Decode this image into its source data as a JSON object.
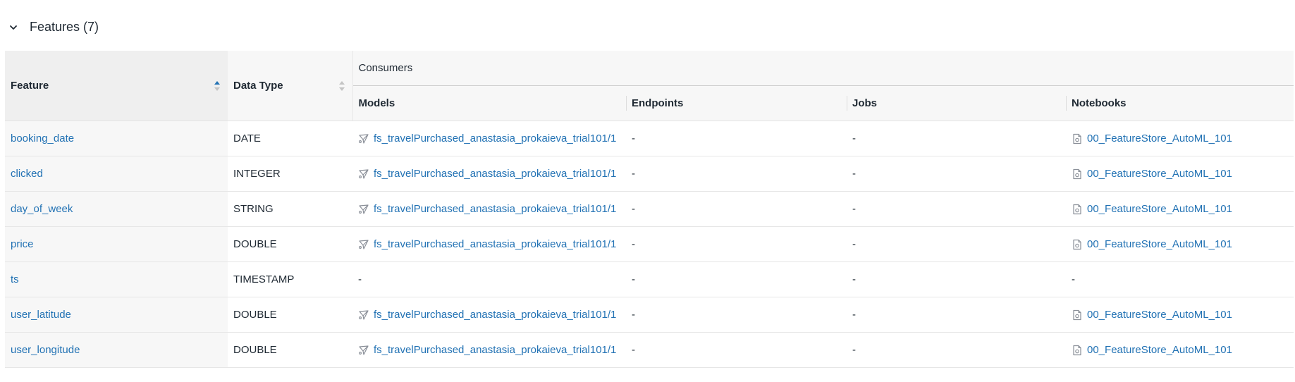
{
  "section": {
    "title": "Features (7)"
  },
  "columns": {
    "feature": "Feature",
    "data_type": "Data Type",
    "consumers": "Consumers",
    "models": "Models",
    "endpoints": "Endpoints",
    "jobs": "Jobs",
    "notebooks": "Notebooks"
  },
  "rows": [
    {
      "feature": "booking_date",
      "data_type": "DATE",
      "model": "fs_travelPurchased_anastasia_prokaieva_trial101/1",
      "endpoint": "-",
      "job": "-",
      "notebook": "00_FeatureStore_AutoML_101"
    },
    {
      "feature": "clicked",
      "data_type": "INTEGER",
      "model": "fs_travelPurchased_anastasia_prokaieva_trial101/1",
      "endpoint": "-",
      "job": "-",
      "notebook": "00_FeatureStore_AutoML_101"
    },
    {
      "feature": "day_of_week",
      "data_type": "STRING",
      "model": "fs_travelPurchased_anastasia_prokaieva_trial101/1",
      "endpoint": "-",
      "job": "-",
      "notebook": "00_FeatureStore_AutoML_101"
    },
    {
      "feature": "price",
      "data_type": "DOUBLE",
      "model": "fs_travelPurchased_anastasia_prokaieva_trial101/1",
      "endpoint": "-",
      "job": "-",
      "notebook": "00_FeatureStore_AutoML_101"
    },
    {
      "feature": "ts",
      "data_type": "TIMESTAMP",
      "model": "-",
      "endpoint": "-",
      "job": "-",
      "notebook": "-"
    },
    {
      "feature": "user_latitude",
      "data_type": "DOUBLE",
      "model": "fs_travelPurchased_anastasia_prokaieva_trial101/1",
      "endpoint": "-",
      "job": "-",
      "notebook": "00_FeatureStore_AutoML_101"
    },
    {
      "feature": "user_longitude",
      "data_type": "DOUBLE",
      "model": "fs_travelPurchased_anastasia_prokaieva_trial101/1",
      "endpoint": "-",
      "job": "-",
      "notebook": "00_FeatureStore_AutoML_101"
    }
  ],
  "icons": {
    "collapse": "chevron-down-icon",
    "model": "model-icon",
    "notebook": "notebook-icon",
    "sort": "sort-icon"
  },
  "colors": {
    "link": "#2272b4",
    "sort_active": "#2272b4"
  }
}
